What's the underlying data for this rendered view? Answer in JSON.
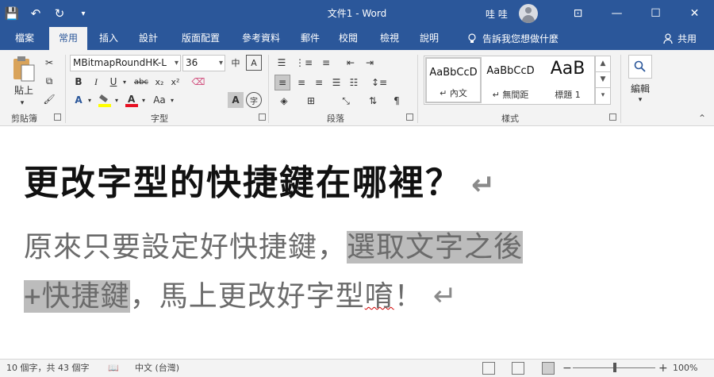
{
  "titlebar": {
    "document_title": "文件1 - Word",
    "user_name": "哇 哇",
    "save_icon": "💾",
    "undo_icon": "↶",
    "redo_icon": "↻",
    "customize_icon": "▾",
    "ribbon_display_icon": "⊡",
    "minimize": "—",
    "maximize": "☐",
    "close": "✕"
  },
  "tabs": [
    "檔案",
    "常用",
    "插入",
    "設計",
    "版面配置",
    "參考資料",
    "郵件",
    "校閱",
    "檢視",
    "說明"
  ],
  "tell_me": "告訴我您想做什麼",
  "share": "共用",
  "clipboard": {
    "paste": "貼上",
    "group_label": "剪貼簿"
  },
  "font": {
    "name": "MBitmapRoundHK-L",
    "size": "36",
    "group_label": "字型",
    "bold": "B",
    "italic": "I",
    "underline": "U",
    "strike": "abc",
    "subscript": "x₂",
    "superscript": "x²",
    "change_case": "Aa",
    "char_border": "A",
    "enclose": "字"
  },
  "paragraph": {
    "group_label": "段落"
  },
  "styles": {
    "group_label": "樣式",
    "items": [
      {
        "sample": "AaBbCcD",
        "name": "↵ 內文"
      },
      {
        "sample": "AaBbCcD",
        "name": "↵ 無間距"
      },
      {
        "sample": "AaB",
        "name": "標題 1"
      }
    ]
  },
  "editing": {
    "label": "編輯"
  },
  "document": {
    "heading": "更改字型的快捷鍵在哪裡？",
    "body1_plain": "原來只要設定好快捷鍵，",
    "body1_highlight": "選取文字之後",
    "body2_highlight": "+快捷鍵",
    "body2_plain": "，馬上更改好字型",
    "body2_squiggle": "唷",
    "body2_end": "！",
    "paragraph_mark": "↵"
  },
  "status": {
    "word_count": "10 個字，共 43 個字",
    "language": "中文 (台灣)",
    "zoom_minus": "−",
    "zoom_plus": "+",
    "zoom": "100%"
  },
  "colors": {
    "word_blue": "#2b579a",
    "highlight_gray": "#bcbcbc",
    "font_red": "#e81123",
    "highlight_yellow": "#ffff00"
  }
}
